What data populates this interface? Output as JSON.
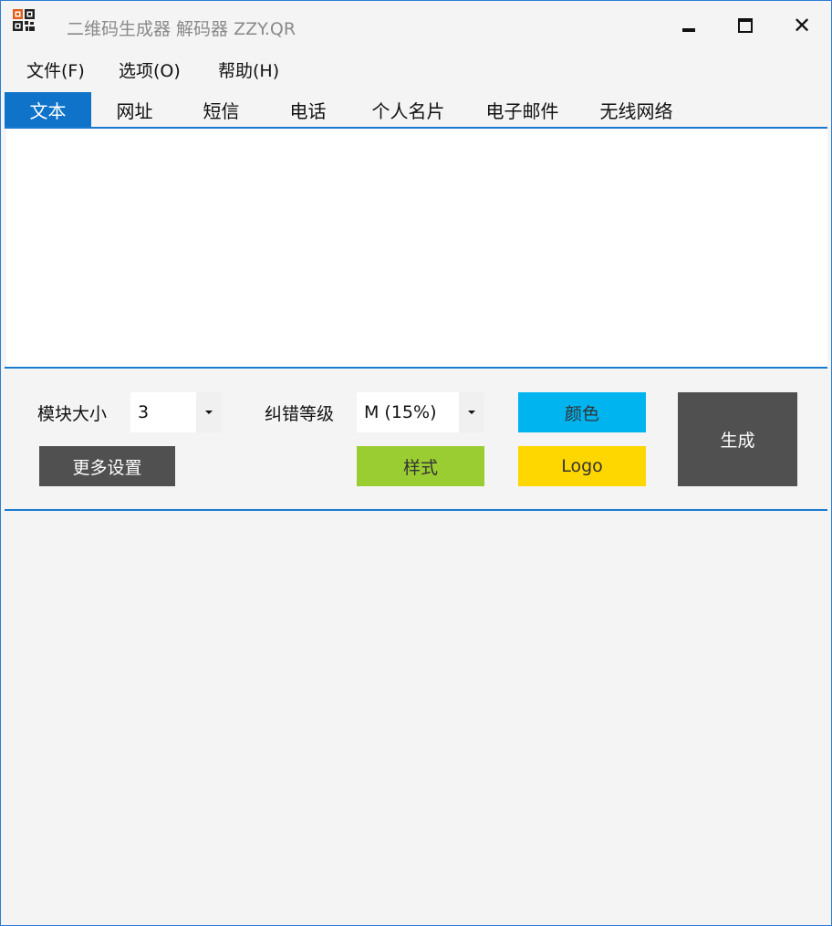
{
  "window": {
    "title": "二维码生成器 解码器 ZZY.QR",
    "close_glyph": "✕"
  },
  "menu": {
    "file": "文件(F)",
    "options": "选项(O)",
    "help": "帮助(H)"
  },
  "tabs": [
    {
      "label": "文本",
      "active": true
    },
    {
      "label": "网址",
      "active": false
    },
    {
      "label": "短信",
      "active": false
    },
    {
      "label": "电话",
      "active": false
    },
    {
      "label": "个人名片",
      "active": false
    },
    {
      "label": "电子邮件",
      "active": false
    },
    {
      "label": "无线网络",
      "active": false
    }
  ],
  "text_input": {
    "value": ""
  },
  "settings": {
    "module_size_label": "模块大小",
    "module_size_value": "3",
    "ecc_label": "纠错等级",
    "ecc_value": "M (15%)",
    "color_button": "颜色",
    "generate_button": "生成",
    "more_settings_button": "更多设置",
    "style_button": "样式",
    "logo_button": "Logo"
  },
  "colors": {
    "accent": "#0f73c9",
    "color_button": "#00b4f0",
    "style_button": "#9acd32",
    "logo_button": "#ffd700",
    "dark_button": "#505050"
  },
  "icons": {
    "app": "qr-code-icon",
    "minimize": "minimize-icon",
    "maximize": "maximize-icon",
    "close": "close-icon",
    "dropdown": "chevron-down-icon"
  }
}
